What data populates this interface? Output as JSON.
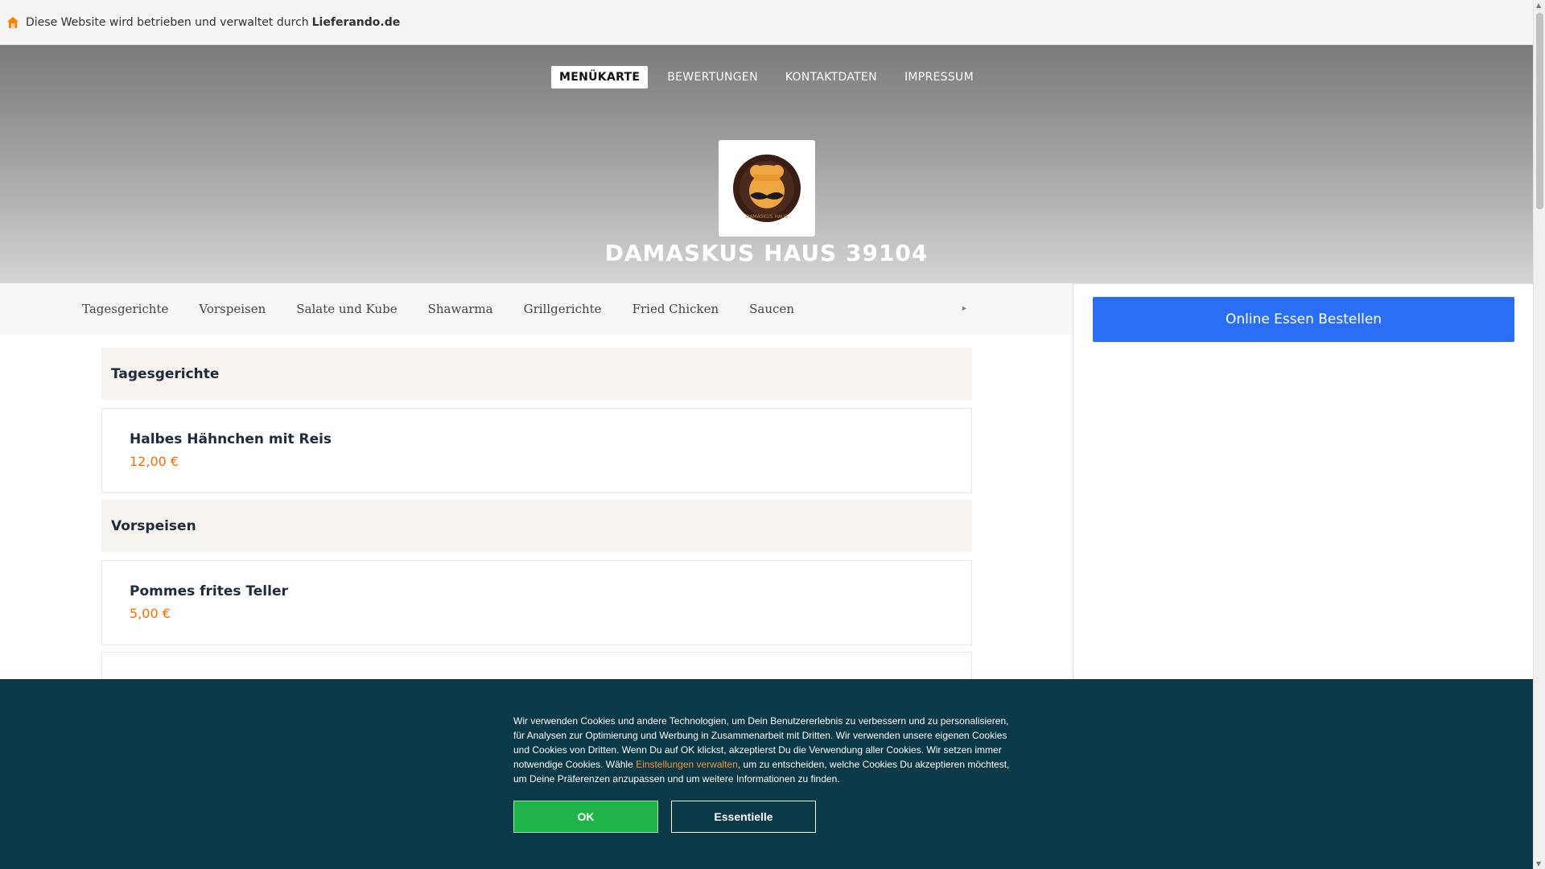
{
  "topbar": {
    "text": "Diese Website wird betrieben und verwaltet durch",
    "brand": "Lieferando.de",
    "icon": "home-icon"
  },
  "nav": {
    "items": [
      {
        "label": "MENÜKARTE",
        "active": true
      },
      {
        "label": "BEWERTUNGEN",
        "active": false
      },
      {
        "label": "KONTAKTDATEN",
        "active": false
      },
      {
        "label": "IMPRESSUM",
        "active": false
      }
    ]
  },
  "restaurant": {
    "name": "DAMASKUS HAUS 39104",
    "logo_text": "DAMASKUS HAUS"
  },
  "categories": {
    "items": [
      "Tagesgerichte",
      "Vorspeisen",
      "Salate und Kube",
      "Shawarma",
      "Grillgerichte",
      "Fried Chicken",
      "Saucen"
    ],
    "more_icon": "chevron-right-icon"
  },
  "sidebar": {
    "order_button": "Online Essen Bestellen"
  },
  "menu": {
    "sections": [
      {
        "title": "Tagesgerichte",
        "items": [
          {
            "name": "Halbes Hähnchen mit Reis",
            "price": "12,00 €"
          }
        ]
      },
      {
        "title": "Vorspeisen",
        "items": [
          {
            "name": "Pommes frites Teller",
            "price": "5,00 €"
          }
        ]
      }
    ]
  },
  "cookie": {
    "text_1": "Wir verwenden Cookies und andere Technologien, um Dein Benutzererlebnis zu verbessern und zu personalisieren, für Analysen zur Optimierung und Werbung in Zusammenarbeit mit Dritten. Wir verwenden unsere eigenen Cookies und Cookies von Dritten. Wenn Du auf OK klickst, akzeptierst Du die Verwendung aller Cookies. Wir setzen immer notwendige Cookies. Wähle",
    "link": "Einstellungen verwalten",
    "text_2": ", um zu entscheiden, welche Cookies Du akzeptieren möchtest, um Deine Präferenzen anzupassen und um weitere Informationen zu finden.",
    "ok_label": "OK",
    "essential_label": "Essentielle"
  },
  "colors": {
    "accent_blue": "#2b6ef6",
    "price_orange": "#ff6b00",
    "cookie_bg": "#0a3a47",
    "cookie_ok": "#1fb44a",
    "cookie_link": "#f1963a"
  }
}
